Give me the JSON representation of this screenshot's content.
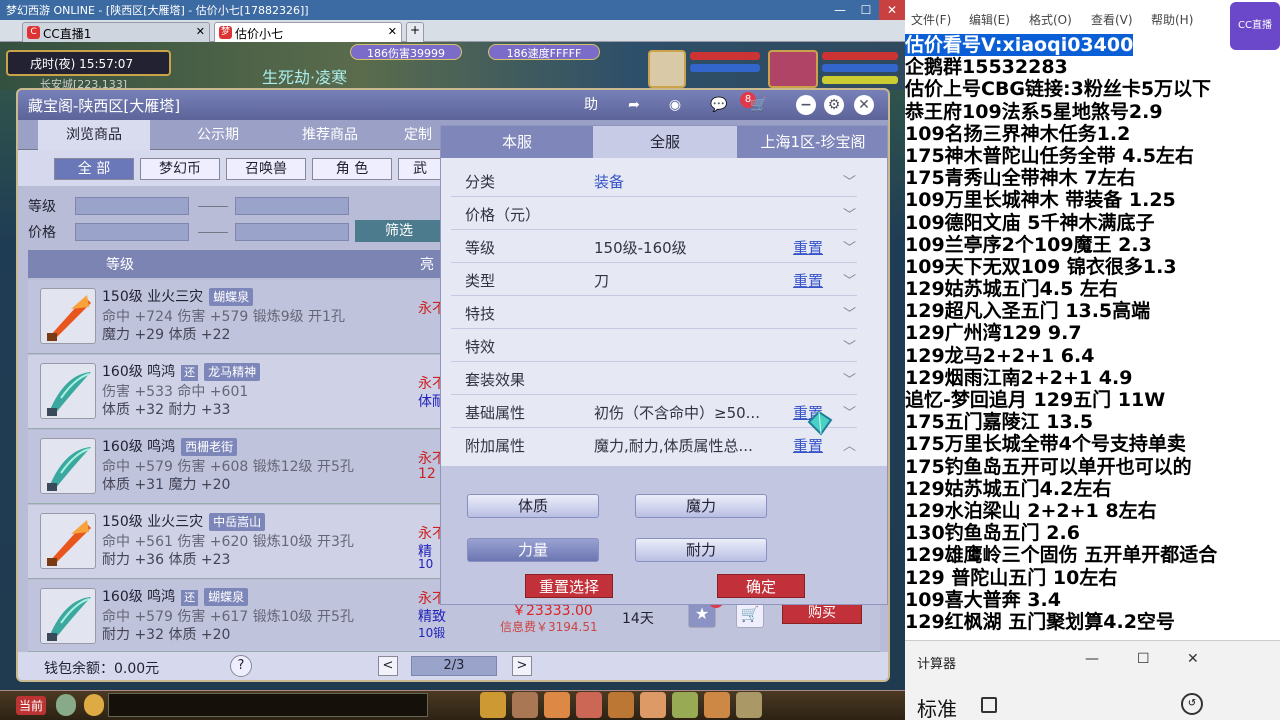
{
  "browser": {
    "title_bar_text": "梦幻西游 ONLINE - [陕西区[大雁塔] - 估价小七[17882326]]",
    "tabs": [
      {
        "label": "CC直播1",
        "icon": "cc-icon"
      },
      {
        "label": "估价小七",
        "icon": "game-icon"
      }
    ],
    "new_tab": "+"
  },
  "game_hud": {
    "time": "戌时(夜) 15:57:07",
    "location": "长安城[223,133]",
    "damage_bubble": "186伤害39999",
    "speed_bubble": "186速度FFFFF",
    "floating_text": "生死劫·凌寒"
  },
  "store": {
    "title": "藏宝阁-陕西区[大雁塔]",
    "header_icons": [
      "help-icon",
      "share-icon",
      "stop-icon",
      "message-icon",
      "cart-icon",
      "minimize-icon",
      "settings-icon",
      "close-icon"
    ],
    "help_label": "助",
    "message_badge": "8",
    "nav_tabs": [
      "浏览商品",
      "公示期",
      "推荐商品",
      "定制"
    ],
    "categories": [
      "全 部",
      "梦幻币",
      "召唤兽",
      "角 色",
      "武"
    ],
    "filter": {
      "level_label": "等级",
      "price_label": "价格",
      "button": "筛选"
    },
    "table_header": {
      "level": "等级",
      "shine": "亮"
    },
    "items": [
      {
        "name": "150级 业火三灾",
        "tag": "蝴蝶泉",
        "line2": "命中 +724 伤害 +579 锻炼9级 开1孔",
        "line3": "魔力 +29 体质 +22",
        "bind": "永不",
        "bind2": "",
        "bind3": "",
        "weapon": "orange"
      },
      {
        "name": "160级 鸣鸿",
        "hui": "还",
        "tag": "龙马精神",
        "line2": "伤害 +533 命中 +601",
        "line3": "体质 +32 耐力 +33",
        "bind": "永不",
        "bind2": "体耐双",
        "bind3": "",
        "weapon": "teal"
      },
      {
        "name": "160级 鸣鸿",
        "tag": "西栅老街",
        "line2": "命中 +579 伤害 +608 锻炼12级 开5孔",
        "line3": "体质 +31 魔力 +20",
        "bind": "永不",
        "bind2": "12",
        "bind3": "",
        "weapon": "teal"
      },
      {
        "name": "150级 业火三灾",
        "tag": "中岳嵩山",
        "line2": "命中 +561 伤害 +620 锻炼10级 开3孔",
        "line3": "耐力 +36 体质 +23",
        "bind": "永不",
        "bind2": "精",
        "bind3": "10",
        "weapon": "orange"
      },
      {
        "name": "160级 鸣鸿",
        "hui": "还",
        "tag": "蝴蝶泉",
        "line2": "命中 +579 伤害 +617 锻炼10级 开5孔",
        "line3": "耐力 +32 体质 +20",
        "bind": "永不绑损",
        "bind2": "精致",
        "bind3": "10锻",
        "weapon": "teal"
      }
    ],
    "last_item_price": "￥23333.00",
    "last_item_fee": "信息费￥3194.51",
    "last_item_days": "14天",
    "fav_badge": "2",
    "buy_button": "购买",
    "wallet": "钱包余额：0.00元",
    "help_q": "?",
    "prev": "<",
    "next": ">",
    "page": "2/3"
  },
  "filter_popup": {
    "tabs": [
      "本服",
      "全服",
      "上海1区-珍宝阁"
    ],
    "active_tab": 1,
    "rows": [
      {
        "label": "分类",
        "value": "装备",
        "value_blue": true,
        "reset": "",
        "chevron": "﹀"
      },
      {
        "label": "价格（元）",
        "value": "",
        "reset": "",
        "chevron": "﹀"
      },
      {
        "label": "等级",
        "value": "150级-160级",
        "reset": "重置",
        "chevron": "﹀"
      },
      {
        "label": "类型",
        "value": "刀",
        "reset": "重置",
        "chevron": "﹀"
      },
      {
        "label": "特技",
        "value": "",
        "reset": "",
        "chevron": "﹀"
      },
      {
        "label": "特效",
        "value": "",
        "reset": "",
        "chevron": "﹀"
      },
      {
        "label": "套装效果",
        "value": "",
        "reset": "",
        "chevron": "﹀"
      },
      {
        "label": "基础属性",
        "value": "初伤（不含命中）≥50...",
        "reset": "重置",
        "chevron": "﹀"
      },
      {
        "label": "附加属性",
        "value": "魔力,耐力,体质属性总...",
        "reset": "重置",
        "chevron": "︿"
      }
    ],
    "attr_buttons": [
      "体质",
      "魔力",
      "力量",
      "耐力"
    ],
    "reset_selection": "重置选择",
    "confirm": "确定"
  },
  "game_bar": {
    "label": "当前"
  },
  "notepad": {
    "menu": [
      "文件(F)",
      "编辑(E)",
      "格式(O)",
      "查看(V)",
      "帮助(H)"
    ],
    "lines": [
      "估价看号V:xiaoqi03400",
      "企鹅群15532283",
      "估价上号CBG链接:3粉丝卡5万以下",
      "恭王府109法系5星地煞号2.9",
      "109名扬三界神木任务1.2",
      "175神木普陀山任务全带 4.5左右",
      "175青秀山全带神木  7左右",
      "109万里长城神木 带装备  1.25",
      "109德阳文庙 5千神木满底子",
      "109兰亭序2个109魔王 2.3",
      "109天下无双109  锦衣很多1.3",
      "129姑苏城五门4.5 左右",
      "129超凡入圣五门  13.5高端",
      "129广州湾129 9.7",
      "129龙马2+2+1  6.4",
      "129烟雨江南2+2+1  4.9",
      "追忆-梦回追月 129五门 11W",
      "175五门嘉陵江 13.5",
      "175万里长城全带4个号支持单卖",
      "175钓鱼岛五开可以单开也可以的",
      "129姑苏城五门4.2左右",
      "129水泊梁山 2+2+1 8左右",
      "130钓鱼岛五门  2.6",
      "129雄鹰岭三个固伤 五开单开都适合",
      "129 普陀山五门  10左右",
      "109喜大普奔  3.4",
      "129红枫湖 五门聚划算4.2空号"
    ],
    "cc_logo": "CC直播"
  },
  "calculator": {
    "title": "计算器",
    "mode": "标准",
    "controls": [
      "—",
      "☐",
      "✕"
    ]
  }
}
